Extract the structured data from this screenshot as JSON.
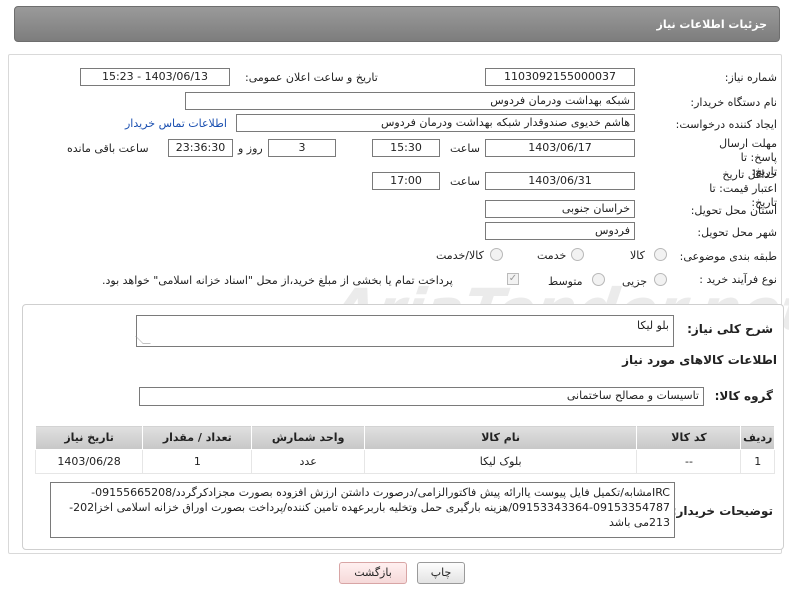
{
  "header": {
    "title": "جزئیات اطلاعات نیاز"
  },
  "fields": {
    "need_number_label": "شماره نیاز:",
    "need_number": "1103092155000037",
    "announce_label": "تاریخ و ساعت اعلان عمومی:",
    "announce_value": "1403/06/13 - 15:23",
    "buyer_org_label": "نام دستگاه خریدار:",
    "buyer_org": "شبکه بهداشت ودرمان فردوس",
    "requester_label": "ایجاد کننده درخواست:",
    "requester": "هاشم خدیوی صندوقدار شبکه بهداشت ودرمان فردوس",
    "contact_link": "اطلاعات تماس خریدار",
    "reply_deadline_label": "مهلت ارسال پاسخ: تا تاریخ:",
    "reply_date": "1403/06/17",
    "time_label": "ساعت",
    "reply_time": "15:30",
    "days_value": "3",
    "days_label": "روز و",
    "remaining_value": "23:36:30",
    "remaining_label": "ساعت باقی مانده",
    "price_validity_label": "حداقل تاریخ اعتبار قیمت: تا تاریخ:",
    "price_date": "1403/06/31",
    "price_time": "17:00",
    "province_label": "استان محل تحویل:",
    "province": "خراسان جنوبی",
    "city_label": "شهر محل تحویل:",
    "city": "فردوس",
    "category_label": "طبقه بندی موضوعی:",
    "category_options": [
      "کالا",
      "خدمت",
      "کالا/خدمت"
    ],
    "category_selected": "کالا",
    "process_label": "نوع فرآیند خرید :",
    "process_options": [
      "جزیی",
      "متوسط"
    ],
    "payment_note": "پرداخت تمام یا بخشی از مبلغ خرید،از محل \"اسناد خزانه اسلامی\" خواهد بود."
  },
  "details": {
    "general_desc_label": "شرح کلی نیاز:",
    "general_desc": "بلو لیکا",
    "goods_info_title": "اطلاعات کالاهای مورد نیاز",
    "goods_group_label": "گروه کالا:",
    "goods_group": "تاسیسات و مصالح ساختمانی",
    "table": {
      "headers": [
        "ردیف",
        "کد کالا",
        "نام کالا",
        "واحد شمارش",
        "تعداد / مقدار",
        "تاریخ نیاز"
      ],
      "rows": [
        [
          "1",
          "--",
          "بلوک لیکا",
          "عدد",
          "1",
          "1403/06/28"
        ]
      ]
    },
    "buyer_notes_label": "توضیحات خریدار:",
    "buyer_notes": "IRCمشابه/تکمیل فایل پیوست یاارائه پیش فاکتورالزامی/درصورت داشتن ارزش افزوده بصورت مجزادکرگردد/09155665208-09153354787-09153343364/هزینه بارگیری حمل وتخلیه باربرعهده تامین کننده/پرداخت بصورت اوراق خزانه اسلامی اخزا202-213می باشد"
  },
  "buttons": {
    "print": "چاپ",
    "back": "بازگشت"
  },
  "watermark": "AriaTender.net"
}
